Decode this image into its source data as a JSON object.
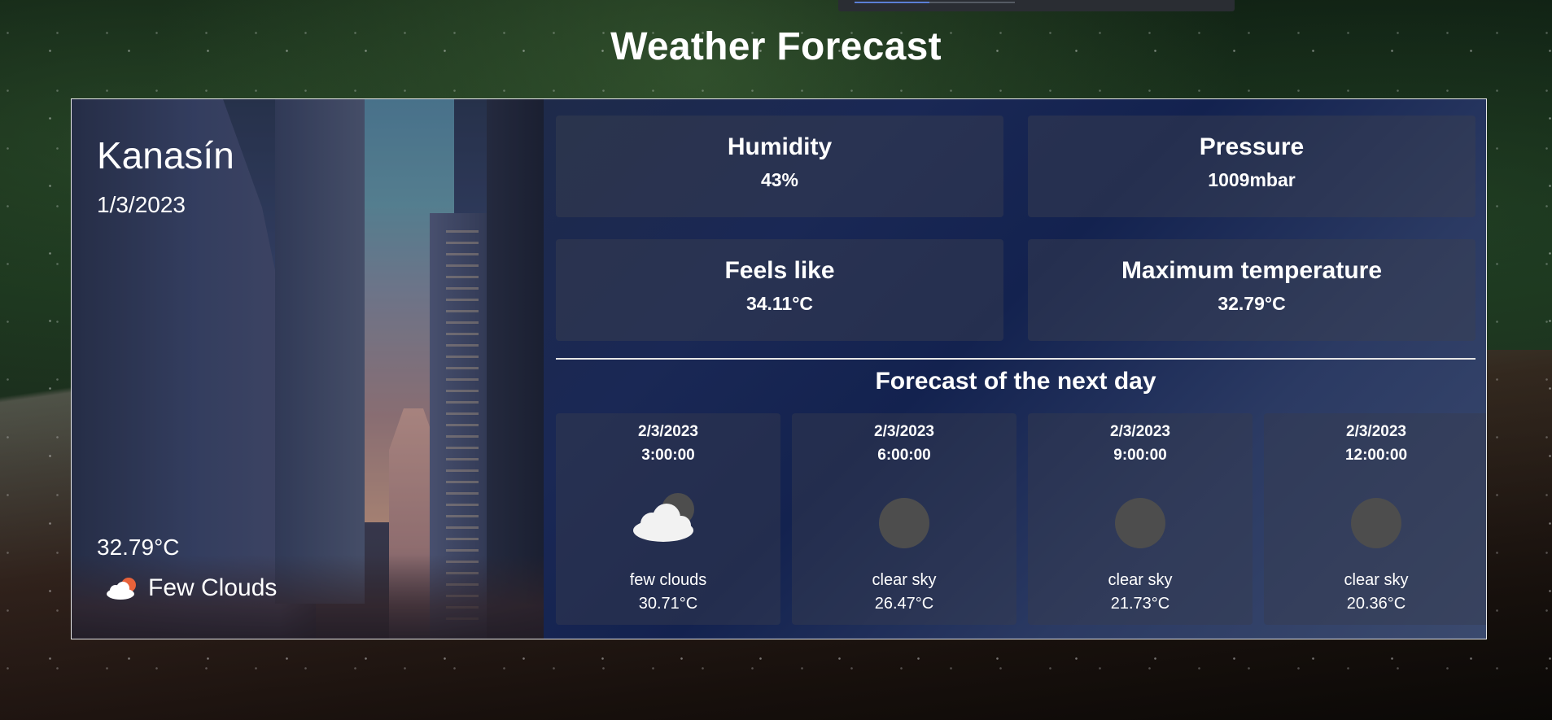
{
  "app": {
    "title": "Weather Forecast"
  },
  "location": {
    "city": "Kanasín",
    "date": "1/3/2023",
    "temperature": "32.79°C",
    "condition": "Few Clouds",
    "condition_icon": "few-clouds-icon"
  },
  "stats": [
    {
      "label": "Humidity",
      "value": "43%"
    },
    {
      "label": "Pressure",
      "value": "1009mbar"
    },
    {
      "label": "Feels like",
      "value": "34.11°C"
    },
    {
      "label": "Maximum temperature",
      "value": "32.79°C"
    }
  ],
  "forecast": {
    "title": "Forecast of the next day",
    "items": [
      {
        "date": "2/3/2023",
        "time": "3:00:00",
        "description": "few clouds",
        "temperature": "30.71°C",
        "icon": "few-clouds-night-icon"
      },
      {
        "date": "2/3/2023",
        "time": "6:00:00",
        "description": "clear sky",
        "temperature": "26.47°C",
        "icon": "clear-night-moon-icon"
      },
      {
        "date": "2/3/2023",
        "time": "9:00:00",
        "description": "clear sky",
        "temperature": "21.73°C",
        "icon": "clear-night-moon-icon"
      },
      {
        "date": "2/3/2023",
        "time": "12:00:00",
        "description": "clear sky",
        "temperature": "20.36°C",
        "icon": "clear-night-moon-icon"
      }
    ]
  },
  "colors": {
    "panel_blue": "#13224f",
    "card_overlay": "#373c4e",
    "moon_gray": "#4d4d4d",
    "sun_orange": "#e8623a"
  }
}
